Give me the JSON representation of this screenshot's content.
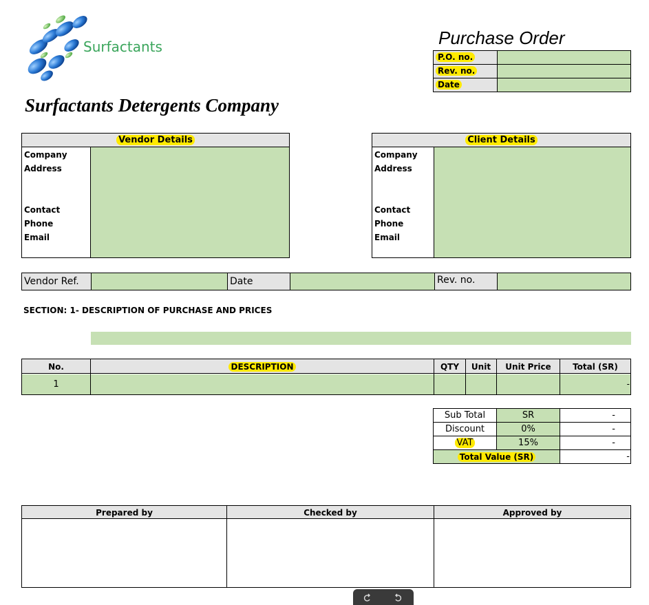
{
  "logo": {
    "text": "Surfactants",
    "brand_color": "#3aa55b",
    "sphere_color": "#1f6fc4"
  },
  "doc_title": "Purchase Order",
  "company_name": "Surfactants Detergents Company",
  "po_fields": [
    {
      "label": "P.O. no.",
      "value": ""
    },
    {
      "label": "Rev. no.",
      "value": ""
    },
    {
      "label": "Date",
      "value": ""
    }
  ],
  "vendor": {
    "header": "Vendor Details",
    "labels": {
      "company": "Company",
      "address": "Address",
      "contact": "Contact",
      "phone": "Phone",
      "email": "Email"
    }
  },
  "client": {
    "header": "Client Details",
    "labels": {
      "company": "Company",
      "address": "Address",
      "contact": "Contact",
      "phone": "Phone",
      "email": "Email"
    }
  },
  "ref_row": {
    "vendor_ref": "Vendor Ref.",
    "date": "Date",
    "rev_no": "Rev. no."
  },
  "section_title": "SECTION: 1- DESCRIPTION OF PURCHASE AND PRICES",
  "items_table": {
    "headers": {
      "no": "No.",
      "description": "DESCRIPTION",
      "qty": "QTY",
      "unit": "Unit",
      "unit_price": "Unit Price",
      "total": "Total (SR)"
    },
    "rows": [
      {
        "no": "1",
        "description": "",
        "qty": "",
        "unit": "",
        "unit_price": "",
        "total": "-"
      }
    ]
  },
  "totals": {
    "sub_total": {
      "label": "Sub Total",
      "mid": "SR",
      "value": "-"
    },
    "discount": {
      "label": "Discount",
      "mid": "0%",
      "value": "-"
    },
    "vat": {
      "label": "VAT",
      "mid": "15%",
      "value": "-"
    },
    "total_value": {
      "label": "Total Value (SR)",
      "value": "-"
    }
  },
  "signatures": {
    "prepared": "Prepared by",
    "checked": "Checked by",
    "approved": "Approved by"
  },
  "colors": {
    "field_green": "#c6e0b4",
    "header_gray": "#e4e4e4",
    "highlight": "#ffea00",
    "toolbar": "#3a3a3a"
  },
  "toolbar": {
    "rotate_left_icon": "rotate-left-icon",
    "rotate_right_icon": "rotate-right-icon"
  }
}
